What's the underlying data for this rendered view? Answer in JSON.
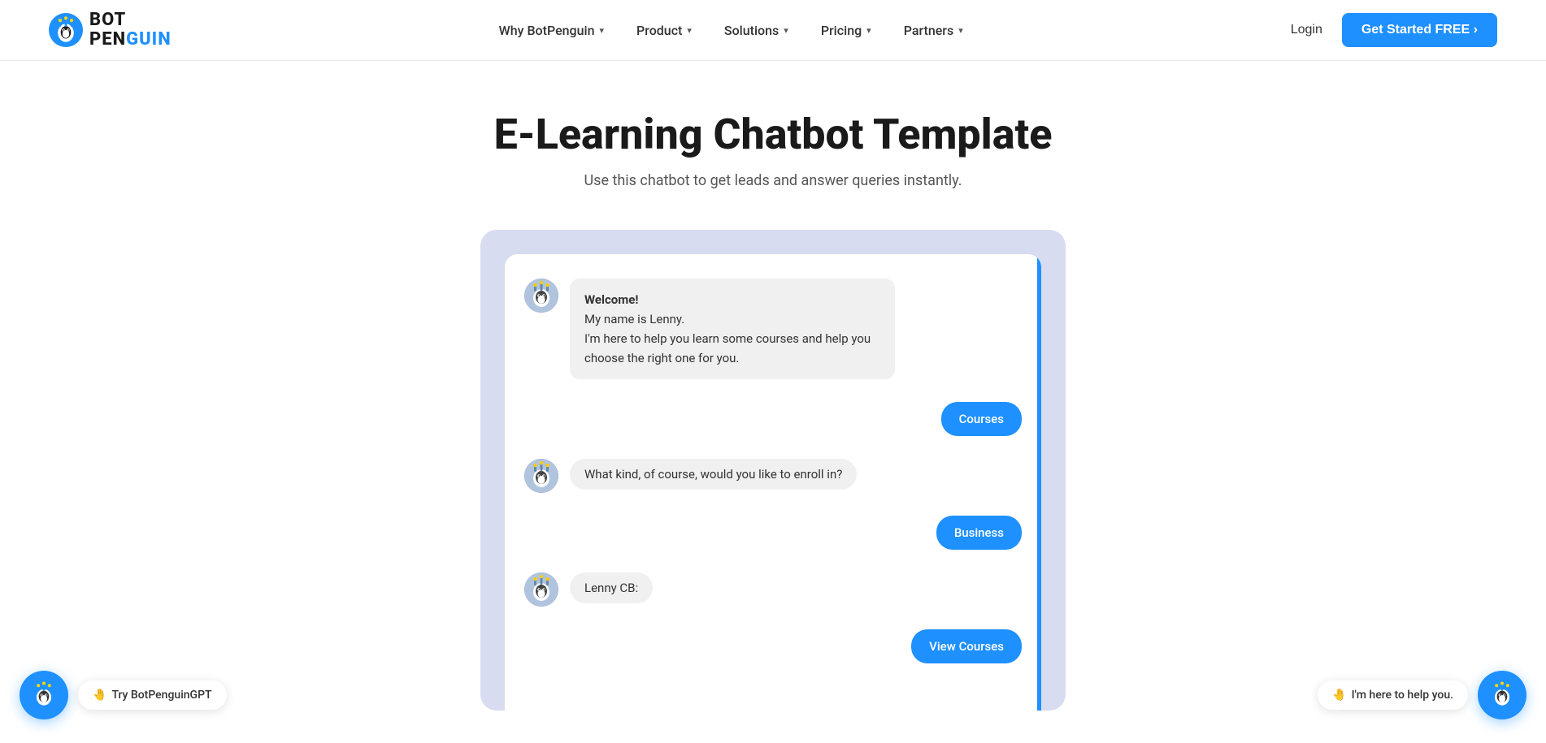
{
  "navbar": {
    "logo_line1": "BOT",
    "logo_line2_black": "PEN",
    "logo_line2_blue": "GUIN",
    "nav_items": [
      {
        "label": "Why BotPenguin",
        "has_dropdown": true
      },
      {
        "label": "Product",
        "has_dropdown": true
      },
      {
        "label": "Solutions",
        "has_dropdown": true
      },
      {
        "label": "Pricing",
        "has_dropdown": true
      },
      {
        "label": "Partners",
        "has_dropdown": true
      }
    ],
    "login_label": "Login",
    "cta_label": "Get Started FREE ›"
  },
  "hero": {
    "title": "E-Learning Chatbot Template",
    "subtitle": "Use this chatbot to get leads and answer queries instantly."
  },
  "chat": {
    "messages": [
      {
        "type": "bot",
        "text": "Welcome!\nMy name is Lenny.\nI'm here to help you learn some courses and help you choose the right one for you."
      },
      {
        "type": "user",
        "text": "Courses"
      },
      {
        "type": "bot",
        "text": "What kind, of course, would you like to enroll in?"
      },
      {
        "type": "user",
        "text": "Business"
      },
      {
        "type": "bot_label",
        "text": "Lenny CB:"
      },
      {
        "type": "user",
        "text": "View Courses"
      }
    ]
  },
  "bottom_left": {
    "emoji": "🤚",
    "label": "Try BotPenguinGPT"
  },
  "bottom_right": {
    "emoji": "🤚",
    "label": "I'm here to help you."
  }
}
